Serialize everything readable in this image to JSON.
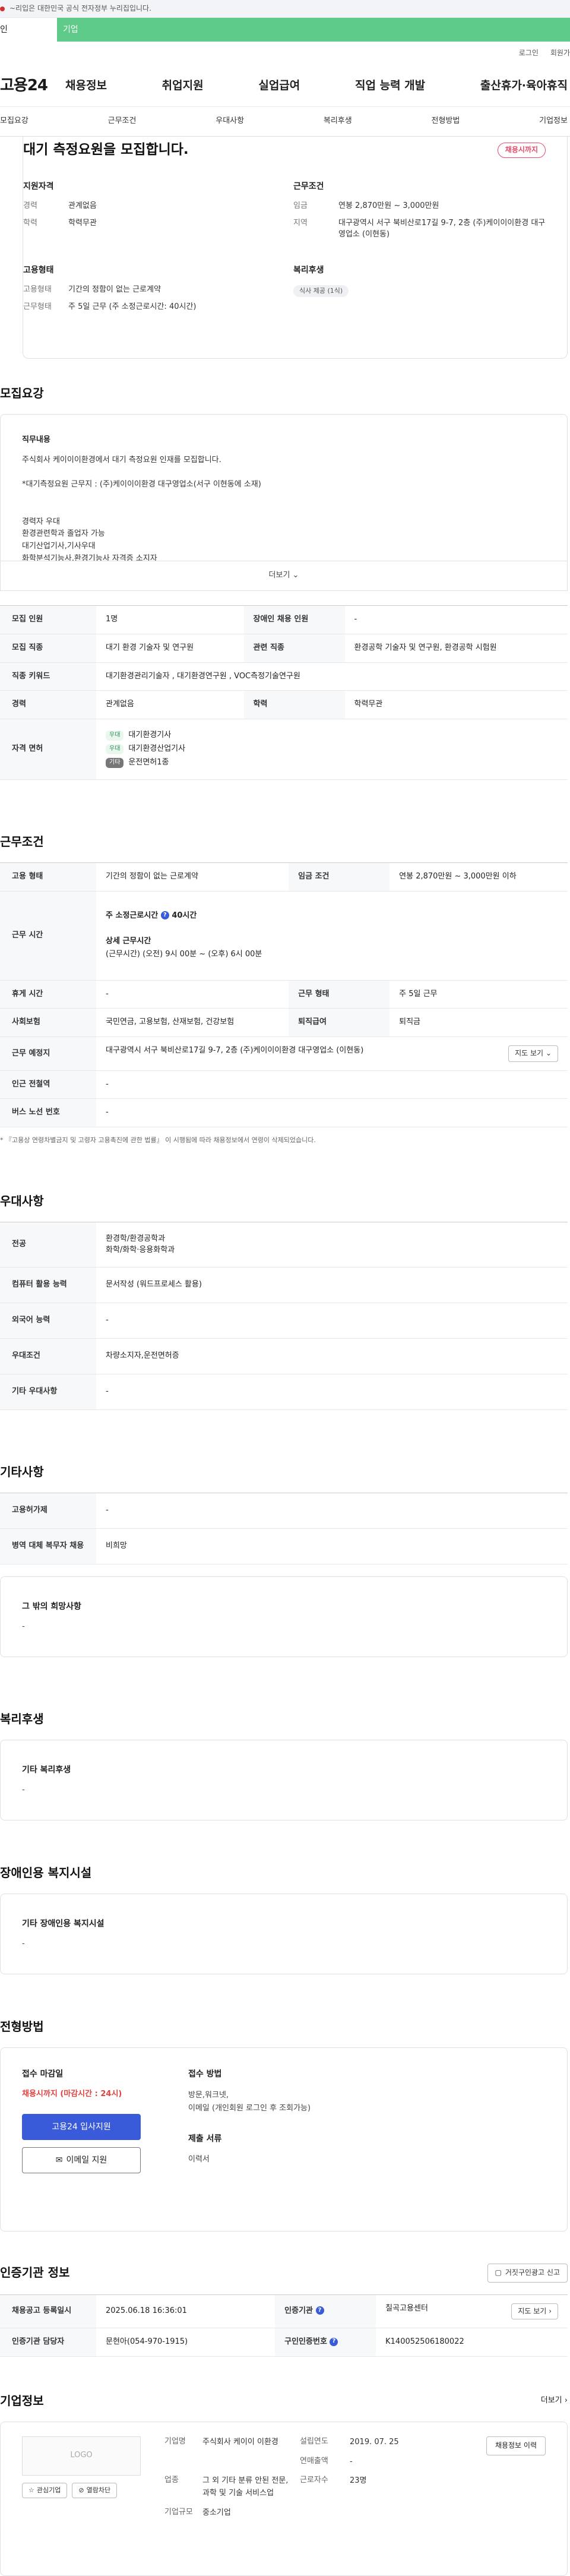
{
  "gov_strip": {
    "text": "~리입은 대한민국 공식 전자정부 누리집입니다."
  },
  "top_tabs": {
    "personal": "인",
    "company": "기업"
  },
  "util_links": [
    "로그인",
    "회원가"
  ],
  "header": {
    "logo": "고용24",
    "nav": [
      "채용정보",
      "취업지원",
      "실업급여",
      "직업 능력 개발",
      "출산휴가·육아휴직"
    ]
  },
  "sub_nav": [
    "모집요강",
    "근무조건",
    "우대사항",
    "복리후생",
    "전형방법",
    "기업정보"
  ],
  "summary": {
    "title": "대기 측정요원을 모집합니다.",
    "badge": "채용시까지",
    "qualification": {
      "heading": "지원자격",
      "rows": [
        {
          "k": "경력",
          "v": "관계없음"
        },
        {
          "k": "학력",
          "v": "학력무관"
        }
      ]
    },
    "conditions": {
      "heading": "근무조건",
      "rows": [
        {
          "k": "임금",
          "v": "연봉 2,870만원 ~ 3,000만원"
        },
        {
          "k": "지역",
          "v": "대구광역시 서구 북비산로17길 9-7, 2층 (주)케이이이환경 대구영업소 (이현동)"
        }
      ]
    },
    "employment": {
      "heading": "고용형태",
      "rows": [
        {
          "k": "고용형태",
          "v": "기간의 정함이 없는 근로계약"
        },
        {
          "k": "근무형태",
          "v": "주 5일 근무 (주 소정근로시간: 40시간)"
        }
      ]
    },
    "welfare": {
      "heading": "복리후생",
      "tag": "식사 제공 (1식)"
    }
  },
  "recruit": {
    "title": "모집요강",
    "content_heading": "직무내용",
    "content_lines": [
      "주식회사 케이이이환경에서 대기 측정요원 인재를 모집합니다.",
      "",
      "*대기측정요원 근무지 : (주)케이이이환경 대구영업소(서구 이현동에 소재)",
      "",
      "",
      "경력자 우대",
      "환경관련학과 졸업자 가능",
      "대기산업기사,기사우대",
      "화학분석기능사,환경기능사 자격증 소지자"
    ],
    "more": "더보기",
    "table": {
      "headcount_k": "모집 인원",
      "headcount_v": "1명",
      "disabled_k": "장애인 채용 인원",
      "disabled_v": "-",
      "occupation_k": "모집 직종",
      "occupation_v": "대기 환경 기술자 및 연구원",
      "related_k": "관련 직종",
      "related_v": "환경공학 기술자 및 연구원, 환경공학 시험원",
      "keyword_k": "직종 키워드",
      "keyword_v": "대기환경관리기술자 , 대기환경연구원 , VOC측정기술연구원",
      "career_k": "경력",
      "career_v": "관계없음",
      "edu_k": "학력",
      "edu_v": "학력무관",
      "license_k": "자격 면허",
      "licenses": [
        {
          "tag": "우대",
          "name": "대기환경기사"
        },
        {
          "tag": "우대",
          "name": "대기환경산업기사"
        },
        {
          "tag": "기타",
          "name": "운전면허1종"
        }
      ]
    }
  },
  "work": {
    "title": "근무조건",
    "type_k": "고용 형태",
    "type_v": "기간의 정함이 없는 근로계약",
    "wage_k": "임금 조건",
    "wage_v": "연봉 2,870만원 ~ 3,000만원 이하",
    "hours_k": "근무 시간",
    "hours_main": "주 소정근로시간",
    "hours_main_v": "40시간",
    "hours_detail_h": "상세 근무시간",
    "hours_detail_v": "(근무시간) (오전) 9시 00분 ~ (오후) 6시 00분",
    "break_k": "휴게 시간",
    "break_v": "-",
    "form_k": "근무 형태",
    "form_v": "주 5일 근무",
    "insurance_k": "사회보험",
    "insurance_v": "국민연금, 고용보험, 산재보험, 건강보험",
    "severance_k": "퇴직급여",
    "severance_v": "퇴직금",
    "addr_k": "근무 예정지",
    "addr_v": "대구광역시 서구 북비산로17길 9-7, 2층 (주)케이이이환경 대구영업소 (이현동)",
    "map_btn": "지도 보기",
    "subway_k": "인근 전철역",
    "subway_v": "-",
    "bus_k": "버스 노선 번호",
    "bus_v": "-",
    "note": "* 『고용상 연령차별금지 및 고령자 고용촉진에 관한 법률』 이 시행됨에 따라 채용정보에서 연령이 삭제되었습니다."
  },
  "preference": {
    "title": "우대사항",
    "major_k": "전공",
    "major_v1": "환경학/환경공학과",
    "major_v2": "화학/화학·응용화학과",
    "computer_k": "컴퓨터 활용 능력",
    "computer_v": "문서작성 (워드프로세스 활용)",
    "lang_k": "외국어 능력",
    "lang_v": "-",
    "cond_k": "우대조건",
    "cond_v": "차량소지자,운전면허증",
    "etc_k": "기타 우대사항",
    "etc_v": "-"
  },
  "other": {
    "title": "기타사항",
    "welfare_k": "고용허가제",
    "welfare_v": "-",
    "military_k": "병역 대체 복무자 채용",
    "military_v": "비희망",
    "extra_h": "그 밖의 희망사항",
    "extra_v": "-"
  },
  "benefits": {
    "title": "복리후생",
    "h": "기타 복리후생",
    "v": "-"
  },
  "disability": {
    "title": "장애인용 복지시설",
    "h": "기타 장애인용 복지시설",
    "v": "-"
  },
  "apply": {
    "title": "전형방법",
    "deadline_h": "접수 마감일",
    "deadline_v": "채용시까지 (마감시간 : 24시)",
    "btn_apply": "고용24 입사지원",
    "btn_email": "이메일 지원",
    "method_h": "접수 방법",
    "method_v1": "방문,워크넷,",
    "method_v2": "이메일 (개인회원 로그인 후 조회가능)",
    "docs_h": "제출 서류",
    "docs_v": "이력서"
  },
  "cert": {
    "title": "인증기관 정보",
    "report_btn": "거짓구인광고 신고",
    "reg_k": "채용공고 등록일시",
    "reg_v": "2025.06.18 16:36:01",
    "agency_k": "인증기관",
    "agency_v": "칠곡고용센터",
    "map_btn": "지도 보기",
    "manager_k": "인증기관 담당자",
    "manager_v": "문현아(054-970-1915)",
    "num_k": "구인인증번호",
    "num_v": "K140052506180022"
  },
  "company": {
    "title": "기업정보",
    "more": "더보기",
    "logo": "LOGO",
    "btn_fav": "관심기업",
    "btn_block": "열람차단",
    "name_k": "기업명",
    "name_v": "주식회사 케이이 이환경",
    "founded_k": "설립연도",
    "founded_v": "2019. 07. 25",
    "sales_k": "연매출액",
    "sales_v": "-",
    "industry_k": "업종",
    "industry_v": "그 외 기타 분류 안된 전문, 과학 및 기술 서비스업",
    "staff_k": "근로자수",
    "staff_v": "23명",
    "scale_k": "기업규모",
    "scale_v": "중소기업",
    "job_list_btn": "채용정보 이력"
  }
}
